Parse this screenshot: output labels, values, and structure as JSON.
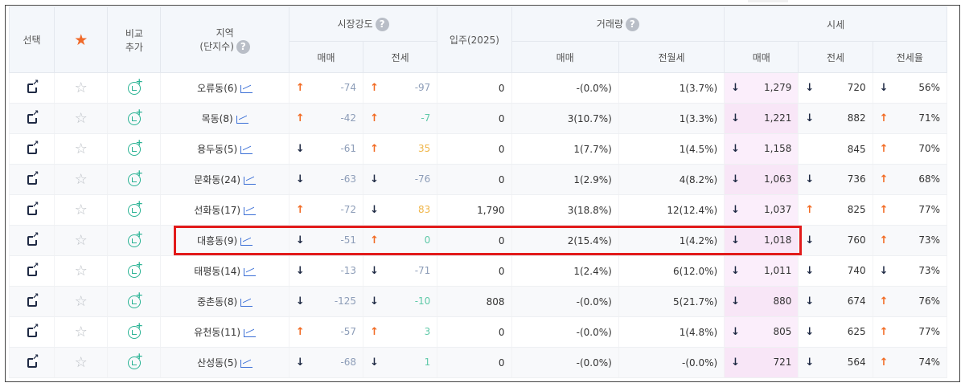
{
  "header": {
    "select": "선택",
    "compare_add_1": "비교",
    "compare_add_2": "추가",
    "region_1": "지역",
    "region_2": "(단지수)",
    "market_strength": "시장강도",
    "move_in": "입주(2025)",
    "volume": "거래량",
    "price": "시세",
    "sub_sale": "매매",
    "sub_jeonse": "전세",
    "sub_sale2": "매매",
    "sub_rent": "전월세",
    "sub_price_sale": "매매",
    "sub_price_jeonse": "전세",
    "sub_ratio": "전세율",
    "help_glyph": "?"
  },
  "rows": [
    {
      "name": "오류동(6)",
      "ms_sale_dir": "up",
      "ms_sale": "-74",
      "ms_j_dir": "up",
      "ms_j": "-97",
      "ms_j_color": "blue",
      "move_in": "0",
      "vol_sale": "-(0.0%)",
      "vol_rent": "1(3.7%)",
      "p_sale_dir": "down",
      "p_sale": "1,279",
      "p_j_dir": "down",
      "p_j": "720",
      "ratio_dir": "down",
      "ratio": "56%"
    },
    {
      "name": "목동(8)",
      "ms_sale_dir": "up",
      "ms_sale": "-42",
      "ms_j_dir": "up",
      "ms_j": "-7",
      "ms_j_color": "green",
      "move_in": "0",
      "vol_sale": "3(10.7%)",
      "vol_rent": "1(3.3%)",
      "p_sale_dir": "down",
      "p_sale": "1,221",
      "p_j_dir": "down",
      "p_j": "882",
      "ratio_dir": "up",
      "ratio": "71%"
    },
    {
      "name": "용두동(5)",
      "ms_sale_dir": "down",
      "ms_sale": "-61",
      "ms_j_dir": "up",
      "ms_j": "35",
      "ms_j_color": "yellow",
      "move_in": "0",
      "vol_sale": "1(7.7%)",
      "vol_rent": "1(4.5%)",
      "p_sale_dir": "down",
      "p_sale": "1,158",
      "p_j_dir": "",
      "p_j": "845",
      "ratio_dir": "up",
      "ratio": "70%"
    },
    {
      "name": "문화동(24)",
      "ms_sale_dir": "down",
      "ms_sale": "-63",
      "ms_j_dir": "down",
      "ms_j": "-76",
      "ms_j_color": "blue",
      "move_in": "0",
      "vol_sale": "1(2.9%)",
      "vol_rent": "4(8.2%)",
      "p_sale_dir": "down",
      "p_sale": "1,063",
      "p_j_dir": "down",
      "p_j": "736",
      "ratio_dir": "up",
      "ratio": "68%"
    },
    {
      "name": "선화동(17)",
      "ms_sale_dir": "up",
      "ms_sale": "-72",
      "ms_j_dir": "down",
      "ms_j": "83",
      "ms_j_color": "yellow",
      "move_in": "1,790",
      "vol_sale": "3(18.8%)",
      "vol_rent": "12(12.4%)",
      "p_sale_dir": "down",
      "p_sale": "1,037",
      "p_j_dir": "up",
      "p_j": "825",
      "ratio_dir": "up",
      "ratio": "77%"
    },
    {
      "name": "대흥동(9)",
      "ms_sale_dir": "down",
      "ms_sale": "-51",
      "ms_j_dir": "up",
      "ms_j": "0",
      "ms_j_color": "green",
      "move_in": "0",
      "vol_sale": "2(15.4%)",
      "vol_rent": "1(4.2%)",
      "p_sale_dir": "down",
      "p_sale": "1,018",
      "p_j_dir": "down",
      "p_j": "760",
      "ratio_dir": "up",
      "ratio": "73%"
    },
    {
      "name": "태평동(14)",
      "ms_sale_dir": "down",
      "ms_sale": "-13",
      "ms_j_dir": "down",
      "ms_j": "-71",
      "ms_j_color": "blue",
      "move_in": "0",
      "vol_sale": "1(2.4%)",
      "vol_rent": "6(12.0%)",
      "p_sale_dir": "down",
      "p_sale": "1,011",
      "p_j_dir": "down",
      "p_j": "740",
      "ratio_dir": "down",
      "ratio": "73%"
    },
    {
      "name": "중촌동(8)",
      "ms_sale_dir": "down",
      "ms_sale": "-125",
      "ms_j_dir": "down",
      "ms_j": "-10",
      "ms_j_color": "green",
      "move_in": "808",
      "vol_sale": "-(0.0%)",
      "vol_rent": "5(21.7%)",
      "p_sale_dir": "down",
      "p_sale": "880",
      "p_j_dir": "down",
      "p_j": "674",
      "ratio_dir": "up",
      "ratio": "76%"
    },
    {
      "name": "유천동(11)",
      "ms_sale_dir": "up",
      "ms_sale": "-57",
      "ms_j_dir": "up",
      "ms_j": "3",
      "ms_j_color": "green",
      "move_in": "0",
      "vol_sale": "-(0.0%)",
      "vol_rent": "1(4.8%)",
      "p_sale_dir": "down",
      "p_sale": "805",
      "p_j_dir": "down",
      "p_j": "625",
      "ratio_dir": "up",
      "ratio": "77%"
    },
    {
      "name": "산성동(5)",
      "ms_sale_dir": "down",
      "ms_sale": "-68",
      "ms_j_dir": "down",
      "ms_j": "1",
      "ms_j_color": "green",
      "move_in": "0",
      "vol_sale": "-(0.0%)",
      "vol_rent": "-(0.0%)",
      "p_sale_dir": "down",
      "p_sale": "721",
      "p_j_dir": "down",
      "p_j": "564",
      "ratio_dir": "up",
      "ratio": "74%"
    }
  ],
  "highlight_row": "대흥동(9)",
  "colors": {
    "up": "#f26a22",
    "down": "#1f2a44",
    "highlight": "#e21a1a",
    "price_bg": "#fbeefb"
  }
}
